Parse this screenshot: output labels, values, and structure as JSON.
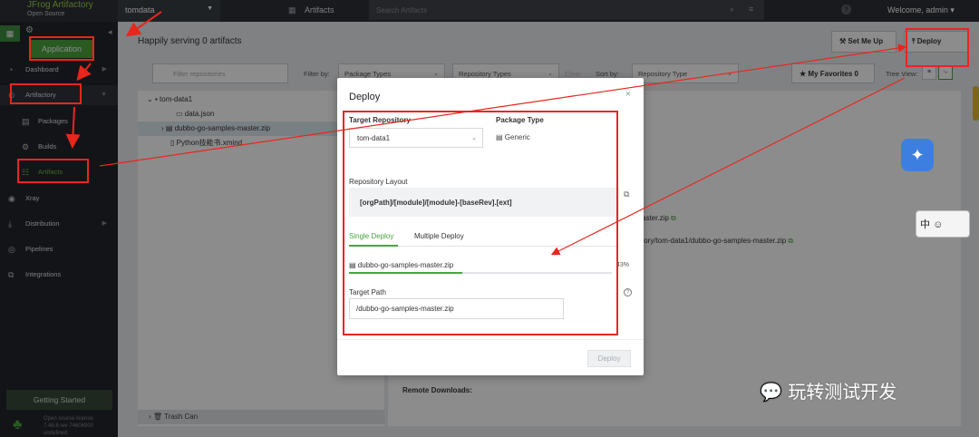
{
  "topbar": {
    "logo_title": "JFrog Artifactory",
    "logo_sub": "Open Source",
    "instance": "tomdata",
    "artifacts_label": "Artifacts",
    "search_placeholder": "Search Artifacts",
    "welcome": "Welcome, admin"
  },
  "sidebar": {
    "application": "Application",
    "items": [
      {
        "label": "Dashboard"
      },
      {
        "label": "Artifactory"
      },
      {
        "label": "Packages"
      },
      {
        "label": "Builds"
      },
      {
        "label": "Artifacts"
      },
      {
        "label": "Xray"
      },
      {
        "label": "Distribution"
      },
      {
        "label": "Pipelines"
      },
      {
        "label": "Integrations"
      }
    ],
    "getting_started": "Getting Started",
    "license_lines": [
      "Open source license",
      "7.46.6 rev 74606900",
      "undefined"
    ]
  },
  "main": {
    "serving": "Happily serving 0 artifacts",
    "set_me_up": "Set Me Up",
    "deploy": "Deploy",
    "filter_placeholder": "Filter repositories",
    "filter_by": "Filter by:",
    "package_types": "Package Types",
    "repository_types": "Repository Types",
    "clear": "Clear",
    "sort_by": "Sort by:",
    "repository_type": "Repository Type",
    "my_favorites": "My Favorites",
    "favorites_count": "0",
    "tree_view": "Tree View:",
    "tree": [
      {
        "label": "tom-data1"
      },
      {
        "label": "data.json"
      },
      {
        "label": "dubbo-go-samples-master.zip"
      },
      {
        "label": "Python技能书.xmind"
      }
    ],
    "trash": "Trash Can",
    "detail_lines": [
      "aster.zip",
      "ctory/tom-data1/dubbo-go-samples-master.zip"
    ],
    "remote_downloads": "Remote Downloads:"
  },
  "modal": {
    "title": "Deploy",
    "target_repository_label": "Target Repository",
    "target_repository_value": "tom-data1",
    "package_type_label": "Package Type",
    "package_type_value": "Generic",
    "repository_layout_label": "Repository Layout",
    "repository_layout_value": "[orgPath]/[module]/[module]-[baseRev].[ext]",
    "tab_single": "Single Deploy",
    "tab_multiple": "Multiple Deploy",
    "file_name": "dubbo-go-samples-master.zip",
    "progress_percent": "43%",
    "progress_value": 0.43,
    "target_path_label": "Target Path",
    "target_path_value": "/dubbo-go-samples-master.zip",
    "deploy_button": "Deploy"
  },
  "watermark": "玩转测试开发",
  "ime_label": "中",
  "colors": {
    "accent_green": "#4aa43f",
    "annotation_red": "#e8261c",
    "topbar": "#2d3035",
    "sidebar": "#23262a"
  }
}
